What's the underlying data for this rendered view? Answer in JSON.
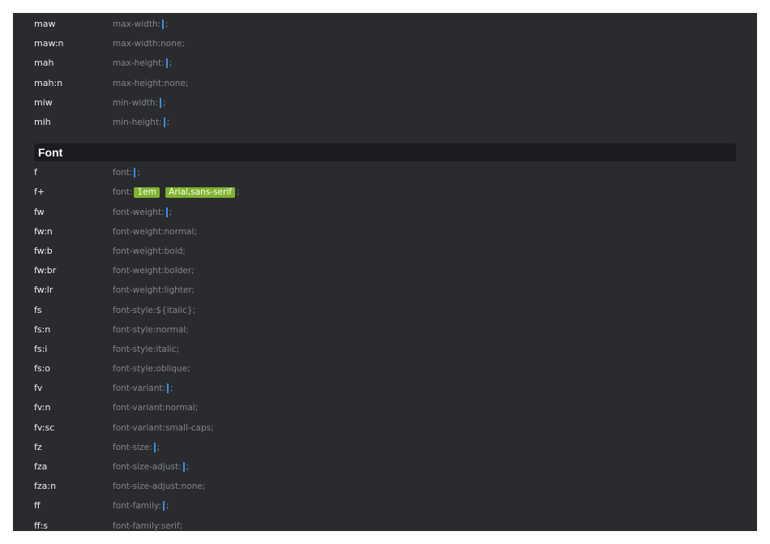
{
  "sizing_rows": [
    {
      "abbr": "maw",
      "parts": [
        "max-width:",
        "|",
        ";"
      ]
    },
    {
      "abbr": "maw:n",
      "parts": [
        "max-width:none;"
      ]
    },
    {
      "abbr": "mah",
      "parts": [
        "max-height:",
        "|",
        ";"
      ]
    },
    {
      "abbr": "mah:n",
      "parts": [
        "max-height:none;"
      ]
    },
    {
      "abbr": "miw",
      "parts": [
        "min-width:",
        "|",
        ";"
      ]
    },
    {
      "abbr": "mih",
      "parts": [
        "min-height:",
        "|",
        ";"
      ]
    }
  ],
  "font_section": {
    "title": "Font",
    "rows": [
      {
        "abbr": "f",
        "parts": [
          "font:",
          "|",
          ";"
        ]
      },
      {
        "abbr": "f+",
        "parts": [
          "font:",
          "[1em]",
          " ",
          "[Arial,sans-serif]",
          ";"
        ]
      },
      {
        "abbr": "fw",
        "parts": [
          "font-weight:",
          "|",
          ";"
        ]
      },
      {
        "abbr": "fw:n",
        "parts": [
          "font-weight:normal;"
        ]
      },
      {
        "abbr": "fw:b",
        "parts": [
          "font-weight:bold;"
        ]
      },
      {
        "abbr": "fw:br",
        "parts": [
          "font-weight:bolder;"
        ]
      },
      {
        "abbr": "fw:lr",
        "parts": [
          "font-weight:lighter;"
        ]
      },
      {
        "abbr": "fs",
        "parts": [
          "font-style:${italic};"
        ]
      },
      {
        "abbr": "fs:n",
        "parts": [
          "font-style:normal;"
        ]
      },
      {
        "abbr": "fs:i",
        "parts": [
          "font-style:italic;"
        ]
      },
      {
        "abbr": "fs:o",
        "parts": [
          "font-style:oblique;"
        ]
      },
      {
        "abbr": "fv",
        "parts": [
          "font-variant:",
          "|",
          ";"
        ]
      },
      {
        "abbr": "fv:n",
        "parts": [
          "font-variant:normal;"
        ]
      },
      {
        "abbr": "fv:sc",
        "parts": [
          "font-variant:small-caps;"
        ]
      },
      {
        "abbr": "fz",
        "parts": [
          "font-size:",
          "|",
          ";"
        ]
      },
      {
        "abbr": "fza",
        "parts": [
          "font-size-adjust:",
          "|",
          ";"
        ]
      },
      {
        "abbr": "fza:n",
        "parts": [
          "font-size-adjust:none;"
        ]
      },
      {
        "abbr": "ff",
        "parts": [
          "font-family:",
          "|",
          ";"
        ]
      },
      {
        "abbr": "ff:s",
        "parts": [
          "font-family:serif;"
        ]
      }
    ]
  },
  "colors": {
    "panel_bg": "#2a2b2f",
    "header_bg": "#1b1c1f",
    "cursor": "#3f8fe6",
    "placeholder": "#7fb32e"
  }
}
